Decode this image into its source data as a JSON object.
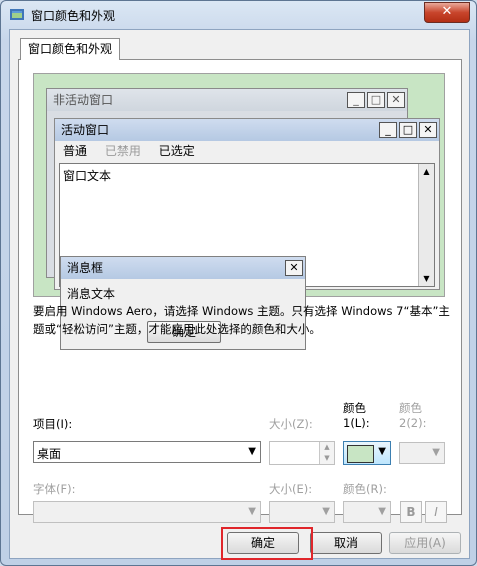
{
  "window": {
    "title": "窗口颜色和外观",
    "close_glyph": "✕"
  },
  "tab": {
    "label": "窗口颜色和外观"
  },
  "preview": {
    "inactive_title": "非活动窗口",
    "active_title": "活动窗口",
    "caption_buttons": [
      "_",
      "□",
      "✕"
    ],
    "menu_normal": "普通",
    "menu_disabled": "已禁用",
    "menu_selected": "已选定",
    "window_text": "窗口文本",
    "message_title": "消息框",
    "message_text": "消息文本",
    "message_ok": "确定",
    "desktop_color": "#c8e5c4"
  },
  "description": "要启用 Windows Aero，请选择 Windows 主题。只有选择 Windows 7“基本”主题或“轻松访问”主题，才能应用此处选择的颜色和大小。",
  "item": {
    "label": "项目(I):",
    "value": "桌面"
  },
  "size1": {
    "label": "大小(Z):",
    "value": ""
  },
  "color1": {
    "label_top": "颜色",
    "label_bottom": "1(L):",
    "value": "#c8e5c4"
  },
  "color2": {
    "label_top": "颜色",
    "label_bottom": "2(2):"
  },
  "font": {
    "label": "字体(F):",
    "value": ""
  },
  "font_size": {
    "label": "大小(E):",
    "value": ""
  },
  "font_color": {
    "label": "颜色(R):"
  },
  "bold_label": "B",
  "italic_label": "I",
  "buttons": {
    "ok": "确定",
    "cancel": "取消",
    "apply": "应用(A)"
  },
  "highlight_color": "#e0262b"
}
